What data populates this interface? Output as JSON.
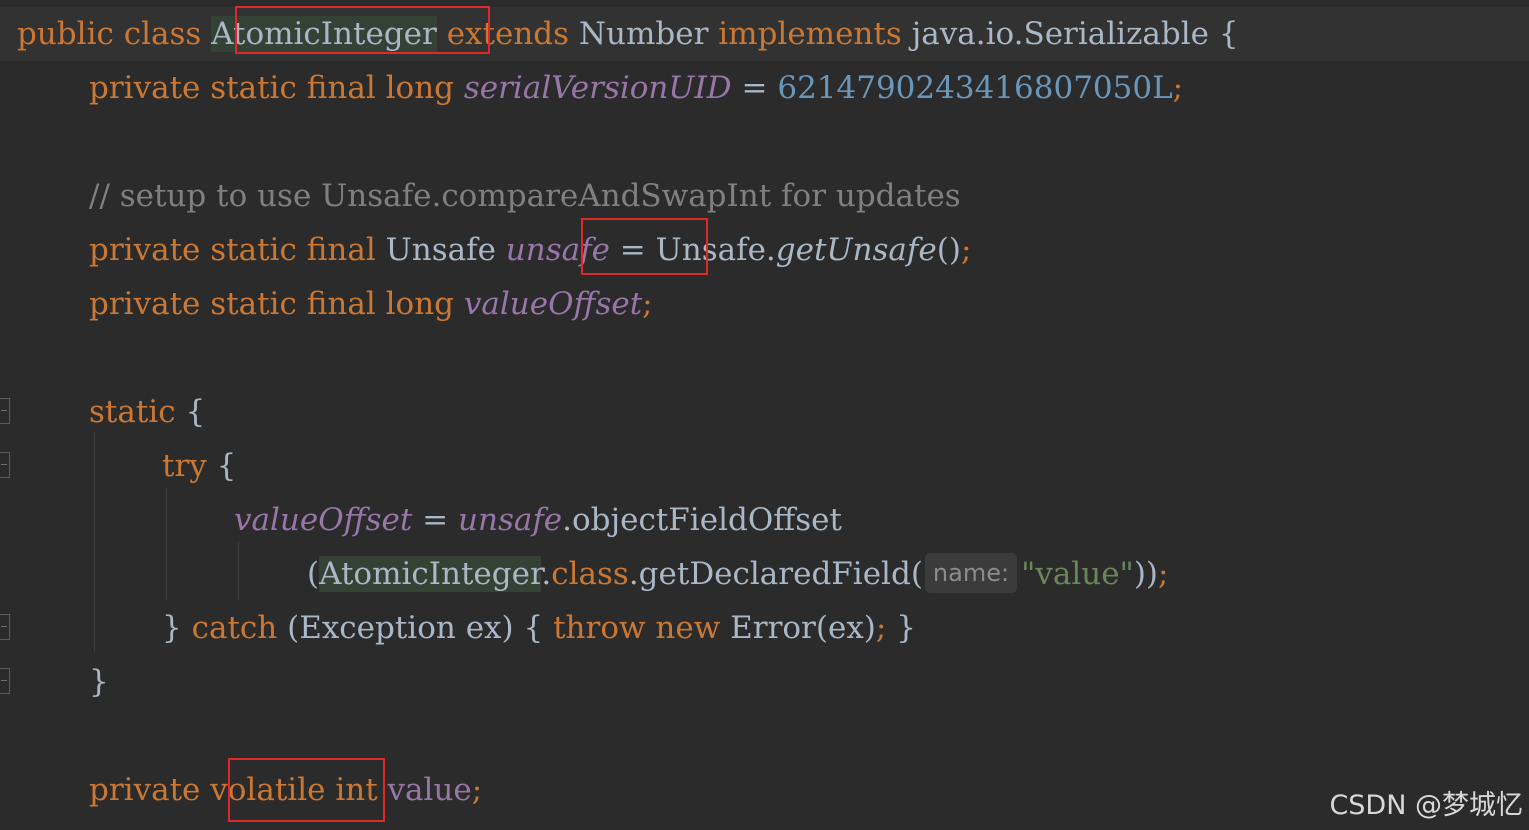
{
  "editor": {
    "tokens": {
      "public": "public",
      "class": "class",
      "class_name": "AtomicInteger",
      "extends": "extends",
      "number": "Number",
      "implements": "implements",
      "serializable": "java.io.Serializable",
      "open_brace": "{",
      "close_brace": "}",
      "private": "private",
      "static": "static",
      "final": "final",
      "long": "long",
      "serial_field": "serialVersionUID",
      "equals": "=",
      "serial_value": "6214790243416807050L",
      "semicolon": ";",
      "comment": "// setup to use Unsafe.compareAndSwapInt for updates",
      "unsafe_type": "Unsafe",
      "unsafe_field": "unsafe",
      "unsafe_class_dot": "Unsafe.",
      "get_unsafe": "getUnsafe",
      "parens_empty": "()",
      "value_offset": "valueOffset",
      "try": "try",
      "dot": ".",
      "object_field_offset": "objectFieldOffset",
      "open_paren": "(",
      "class_keyword_dot": "class",
      "get_declared_field": "getDeclaredField(",
      "hint_label": "name:",
      "value_string": "\"value\"",
      "close_parens": "))",
      "catch": "catch",
      "exception_clause": "(Exception ex)",
      "throw": "throw",
      "new": "new",
      "error_call": "Error(ex)",
      "volatile": "volatile",
      "int": "int",
      "value": "value"
    }
  },
  "watermark": "CSDN @梦城忆",
  "colors": {
    "background": "#2b2b2b",
    "keyword": "#cc7832",
    "identifier": "#a9b7c6",
    "field": "#9876aa",
    "number": "#6897bb",
    "string": "#6a8759",
    "comment": "#808080",
    "annotation_box": "#e02828"
  }
}
